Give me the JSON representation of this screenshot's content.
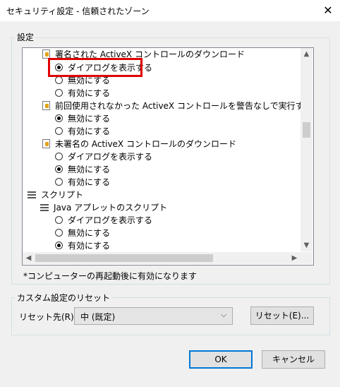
{
  "window": {
    "title": "セキュリティ設定 - 信頼されたゾーン",
    "close_glyph": "✕"
  },
  "settings_group": {
    "label": "設定",
    "items": [
      {
        "type": "header",
        "label": "署名された ActiveX コントロールのダウンロード"
      },
      {
        "type": "option",
        "label": "ダイアログを表示する",
        "checked": true
      },
      {
        "type": "option",
        "label": "無効にする",
        "checked": false
      },
      {
        "type": "option",
        "label": "有効にする",
        "checked": false
      },
      {
        "type": "header",
        "label": "前回使用されなかった ActiveX コントロールを警告なしで実行することを許可"
      },
      {
        "type": "option",
        "label": "無効にする",
        "checked": true
      },
      {
        "type": "option",
        "label": "有効にする",
        "checked": false
      },
      {
        "type": "header",
        "label": "未署名の ActiveX コントロールのダウンロード"
      },
      {
        "type": "option",
        "label": "ダイアログを表示する",
        "checked": false
      },
      {
        "type": "option",
        "label": "無効にする",
        "checked": true
      },
      {
        "type": "option",
        "label": "有効にする",
        "checked": false
      },
      {
        "type": "category",
        "label": "スクリプト"
      },
      {
        "type": "header",
        "label": "Java アプレットのスクリプト"
      },
      {
        "type": "option",
        "label": "ダイアログを表示する",
        "checked": false
      },
      {
        "type": "option",
        "label": "無効にする",
        "checked": false
      },
      {
        "type": "option",
        "label": "有効にする",
        "checked": true
      }
    ],
    "note": "*コンピューターの再起動後に有効になります"
  },
  "reset_group": {
    "label": "カスタム設定のリセット",
    "reset_to_label": "リセット先(R):",
    "selected_value": "中 (既定)",
    "reset_button": "リセット(E)..."
  },
  "buttons": {
    "ok": "OK",
    "cancel": "キャンセル"
  },
  "colors": {
    "highlight": "#e00000",
    "default_button_border": "#0078d7"
  }
}
